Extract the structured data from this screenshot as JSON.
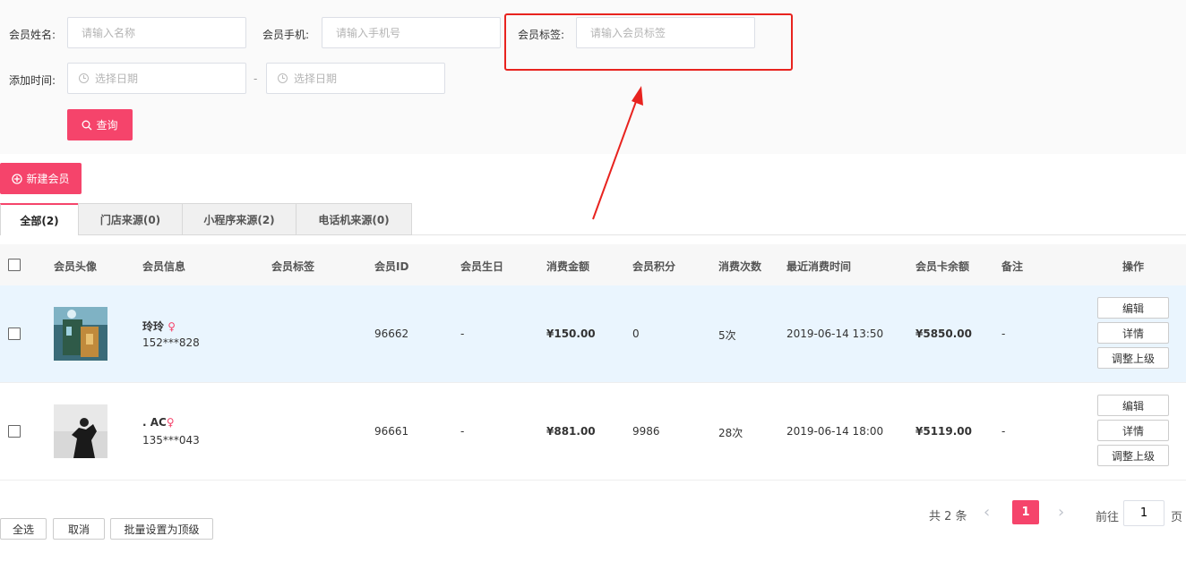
{
  "filters": {
    "name_label": "会员姓名:",
    "name_placeholder": "请输入名称",
    "phone_label": "会员手机:",
    "phone_placeholder": "请输入手机号",
    "tag_label": "会员标签:",
    "tag_placeholder": "请输入会员标签",
    "time_label": "添加时间:",
    "date_start_placeholder": "选择日期",
    "date_sep": "-",
    "date_end_placeholder": "选择日期",
    "query_label": "查询"
  },
  "new_member_label": "新建会员",
  "tabs": [
    {
      "label": "全部(2)",
      "active": true
    },
    {
      "label": "门店来源(0)",
      "active": false
    },
    {
      "label": "小程序来源(2)",
      "active": false
    },
    {
      "label": "电话机来源(0)",
      "active": false
    }
  ],
  "table": {
    "headers": {
      "avatar": "会员头像",
      "info": "会员信息",
      "tag": "会员标签",
      "id": "会员ID",
      "birthday": "会员生日",
      "amount": "消费金额",
      "points": "会员积分",
      "count": "消费次数",
      "last_time": "最近消费时间",
      "balance": "会员卡余额",
      "remark": "备注",
      "ops": "操作"
    },
    "rows": [
      {
        "name": "玲玲",
        "gender": "♀",
        "phone": "152***828",
        "id": "96662",
        "birthday": "-",
        "amount": "¥150.00",
        "points": "0",
        "count": "5次",
        "last_time": "2019-06-14 13:50",
        "balance": "¥5850.00",
        "remark": "-",
        "highlight": true
      },
      {
        "name": ". AC",
        "gender": "♀",
        "phone": "135***043",
        "id": "96661",
        "birthday": "-",
        "amount": "¥881.00",
        "points": "9986",
        "count": "28次",
        "last_time": "2019-06-14 18:00",
        "balance": "¥5119.00",
        "remark": "-",
        "highlight": false
      }
    ],
    "ops": {
      "edit": "编辑",
      "detail": "详情",
      "upgrade": "调整上级"
    }
  },
  "footer": {
    "select_all": "全选",
    "cancel": "取消",
    "batch": "批量设置为顶级"
  },
  "pagination": {
    "total": "共 2 条",
    "current_page": "1",
    "goto_label": "前往",
    "goto_value": "1",
    "page_suffix": "页",
    "prev_icon": "‹",
    "next_icon": "›"
  },
  "colors": {
    "accent": "#f5446b",
    "annotation": "#e8231f",
    "row_highlight": "#eaf5fe"
  }
}
